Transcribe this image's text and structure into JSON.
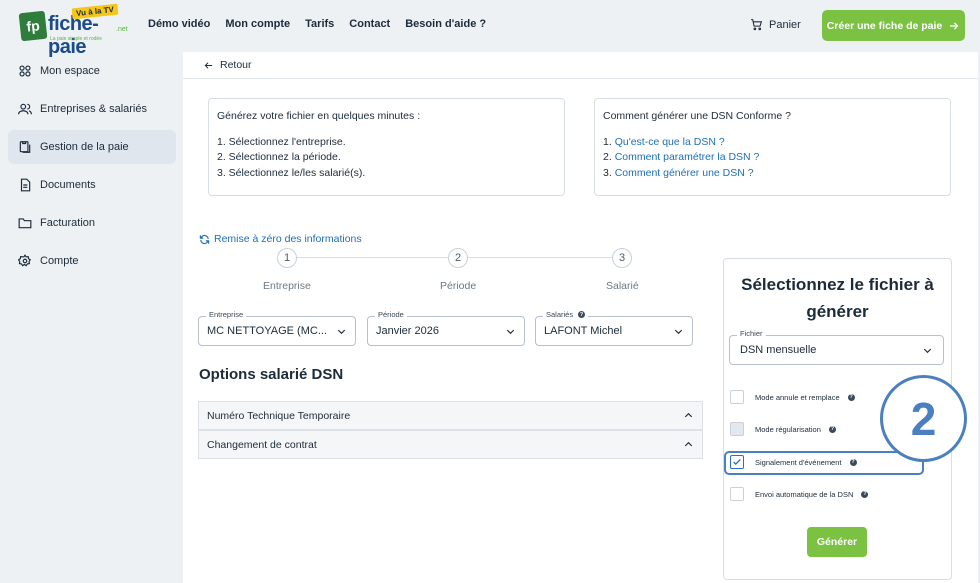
{
  "header": {
    "logo_text": "fiche-paie",
    "logo_badge": "Vu à la TV",
    "logo_net": ".net",
    "logo_tagline": "La paie simple et rodée",
    "nav": [
      "Démo vidéo",
      "Mon compte",
      "Tarifs",
      "Contact"
    ],
    "nav_help": "Besoin d'aide ?",
    "cart": "Panier",
    "cta": "Créer une fiche de paie"
  },
  "sidebar": {
    "items": [
      {
        "label": "Mon espace",
        "icon": "grid-icon"
      },
      {
        "label": "Entreprises & salariés",
        "icon": "users-icon"
      },
      {
        "label": "Gestion de la paie",
        "icon": "payroll-icon"
      },
      {
        "label": "Documents",
        "icon": "document-icon"
      },
      {
        "label": "Facturation",
        "icon": "folder-icon"
      },
      {
        "label": "Compte",
        "icon": "gear-icon"
      }
    ]
  },
  "main": {
    "back": "Retour",
    "box1": {
      "title": "Générez votre fichier en quelques minutes :",
      "items": [
        "1. Sélectionnez l'entreprise.",
        "2. Sélectionnez la période.",
        "3. Sélectionnez le/les salarié(s)."
      ]
    },
    "box2": {
      "title": "Comment générer une DSN Conforme ?",
      "items": [
        {
          "num": "1.",
          "link": "Qu'est-ce que la DSN ?"
        },
        {
          "num": "2.",
          "link": "Comment paramétrer la DSN ?"
        },
        {
          "num": "3.",
          "link": "Comment générer une DSN ?"
        }
      ]
    },
    "reset": "Remise à zéro des informations",
    "steps": [
      {
        "num": "1",
        "label": "Entreprise"
      },
      {
        "num": "2",
        "label": "Période"
      },
      {
        "num": "3",
        "label": "Salarié"
      }
    ],
    "fields": {
      "entreprise": {
        "label": "Entreprise",
        "value": "MC NETTOYAGE (MC..."
      },
      "periode": {
        "label": "Période",
        "value": "Janvier 2026"
      },
      "salaries": {
        "label": "Salariés",
        "value": "LAFONT Michel"
      }
    },
    "options_title": "Options salarié DSN",
    "accordions": [
      "Numéro Technique Temporaire",
      "Changement de contrat"
    ]
  },
  "card": {
    "title_line1": "Sélectionnez le fichier à",
    "title_line2": "générer",
    "file_label": "Fichier",
    "file_value": "DSN mensuelle",
    "options": [
      {
        "label": "Mode annule et remplace",
        "state": "unchecked"
      },
      {
        "label": "Mode régularisation",
        "state": "disabled"
      },
      {
        "label": "Signalement d'événement",
        "state": "checked"
      },
      {
        "label": "Envoi automatique de la DSN",
        "state": "unchecked"
      }
    ],
    "generate": "Générer"
  },
  "annotation": "2",
  "colors": {
    "accent_green": "#7cc242",
    "link_blue": "#1e6fb8",
    "annotation_blue": "#4a7fc0"
  }
}
